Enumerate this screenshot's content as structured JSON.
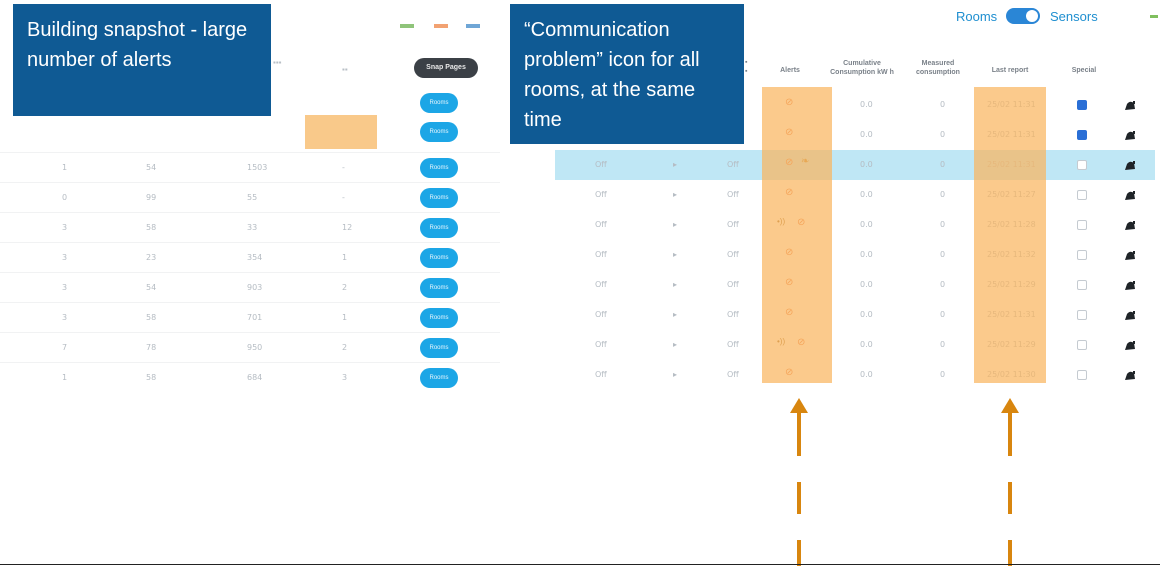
{
  "callouts": {
    "left": "Building snapshot - large number of alerts",
    "right": "“Communication problem” icon for all rooms, at the same time"
  },
  "left_panel": {
    "button": "Snap Pages",
    "row_button": "Rooms",
    "rows": [
      [
        "1",
        "54",
        "1503",
        "-"
      ],
      [
        "0",
        "99",
        "55",
        "-"
      ],
      [
        "3",
        "58",
        "33",
        "12"
      ],
      [
        "3",
        "23",
        "354",
        "1"
      ],
      [
        "3",
        "54",
        "903",
        "2"
      ],
      [
        "3",
        "58",
        "701",
        "1"
      ],
      [
        "7",
        "78",
        "950",
        "2"
      ],
      [
        "1",
        "58",
        "684",
        "3"
      ]
    ]
  },
  "toggle": {
    "left_label": "Rooms",
    "right_label": "Sensors"
  },
  "right_table": {
    "headers": {
      "alerts": "Alerts",
      "cumulative": "Cumulative Consumption kW h",
      "measured": "Measured consumption",
      "last_report": "Last report",
      "special": "Special"
    },
    "rows": [
      {
        "a": "",
        "b": "",
        "c": "",
        "cum": "0.0",
        "meas": "0",
        "report": "25/02 11:31",
        "checked": true
      },
      {
        "a": "",
        "b": "",
        "c": "",
        "cum": "0.0",
        "meas": "0",
        "report": "25/02 11:31",
        "checked": true
      },
      {
        "a": "Off",
        "b": "▸",
        "c": "Off",
        "cum": "0.0",
        "meas": "0",
        "report": "25/02 11:31",
        "checked": false
      },
      {
        "a": "Off",
        "b": "▸",
        "c": "Off",
        "cum": "0.0",
        "meas": "0",
        "report": "25/02 11:27",
        "checked": false
      },
      {
        "a": "Off",
        "b": "▸",
        "c": "Off",
        "cum": "0.0",
        "meas": "0",
        "report": "25/02 11:28",
        "checked": false
      },
      {
        "a": "Off",
        "b": "▸",
        "c": "Off",
        "cum": "0.0",
        "meas": "0",
        "report": "25/02 11:32",
        "checked": false
      },
      {
        "a": "Off",
        "b": "▸",
        "c": "Off",
        "cum": "0.0",
        "meas": "0",
        "report": "25/02 11:29",
        "checked": false
      },
      {
        "a": "Off",
        "b": "▸",
        "c": "Off",
        "cum": "0.0",
        "meas": "0",
        "report": "25/02 11:31",
        "checked": false
      },
      {
        "a": "Off",
        "b": "▸",
        "c": "Off",
        "cum": "0.0",
        "meas": "0",
        "report": "25/02 11:29",
        "checked": false
      },
      {
        "a": "Off",
        "b": "▸",
        "c": "Off",
        "cum": "0.0",
        "meas": "0",
        "report": "25/02 11:30",
        "checked": false
      }
    ]
  },
  "colors": {
    "callout_bg": "#0f5a94",
    "highlight": "#f9b660",
    "arrow": "#d8860f",
    "selected_row": "#bfe7f5",
    "row_button": "#1ca6e6"
  }
}
